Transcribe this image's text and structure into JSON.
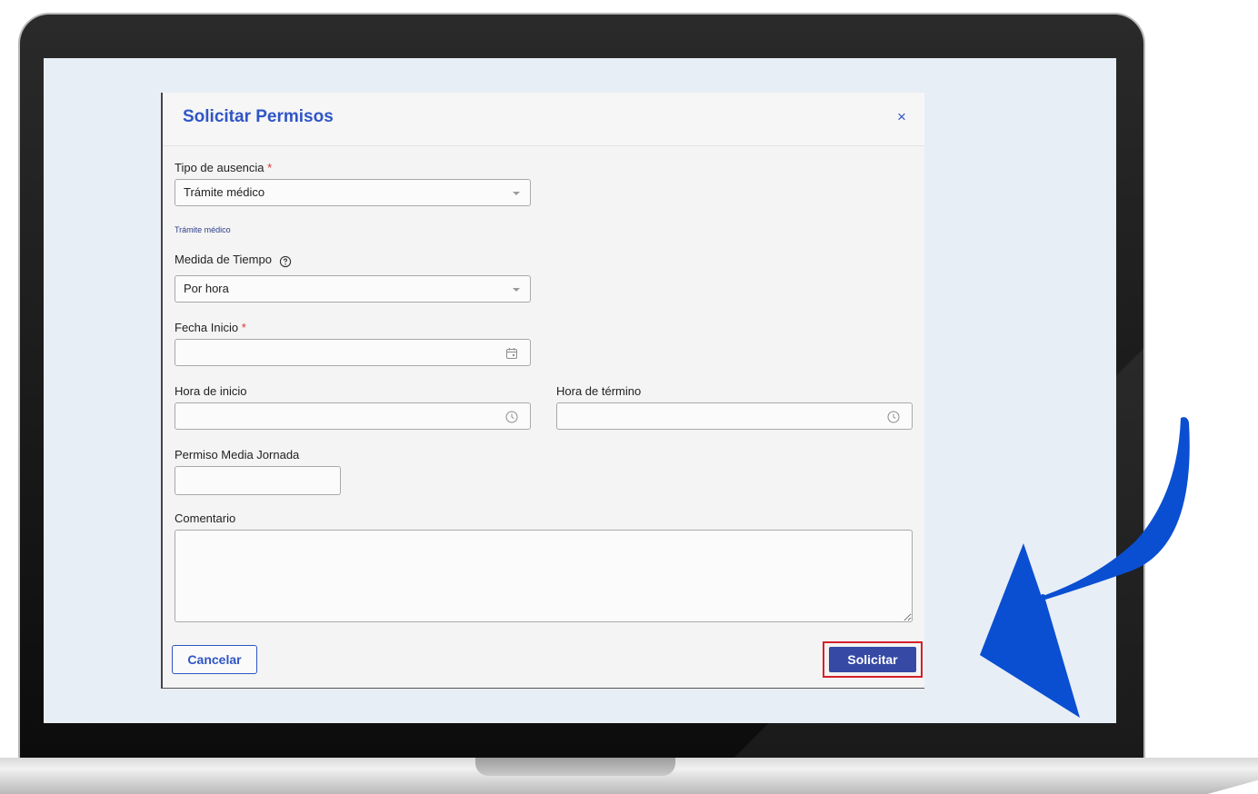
{
  "modal": {
    "title": "Solicitar Permisos",
    "close_glyph": "×"
  },
  "form": {
    "absence_type": {
      "label": "Tipo de ausencia",
      "required_mark": "*",
      "value": "Trámite médico",
      "hint": "Trámite médico"
    },
    "time_measure": {
      "label": "Medida de Tiempo",
      "value": "Por hora",
      "help_icon": "question-circle-icon"
    },
    "start_date": {
      "label": "Fecha Inicio",
      "required_mark": "*",
      "value": "",
      "icon": "calendar-icon"
    },
    "start_time": {
      "label": "Hora de inicio",
      "value": "",
      "icon": "clock-icon"
    },
    "end_time": {
      "label": "Hora de término",
      "value": "",
      "icon": "clock-icon"
    },
    "half_day": {
      "label": "Permiso Media Jornada",
      "value": ""
    },
    "comment": {
      "label": "Comentario",
      "value": ""
    }
  },
  "actions": {
    "cancel_label": "Cancelar",
    "submit_label": "Solicitar"
  },
  "colors": {
    "accent": "#2f55c6",
    "submit_bg": "#3549a5",
    "highlight": "#d6202a",
    "arrow": "#0a4fd1",
    "required": "#e0322f"
  }
}
